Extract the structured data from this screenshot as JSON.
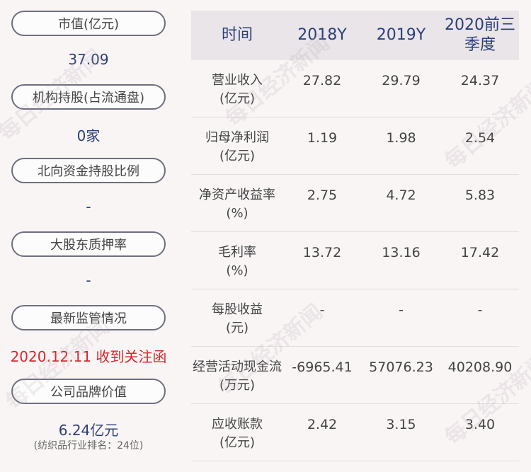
{
  "left_panel": [
    {
      "label": "市值(亿元)",
      "value": "37.09"
    },
    {
      "label": "机构持股(占流通盘)",
      "value": "0家"
    },
    {
      "label": "北向资金持股比例",
      "value": "-"
    },
    {
      "label": "大股东质押率",
      "value": "-"
    },
    {
      "label": "最新监管情况",
      "value": "2020.12.11 收到关注函"
    },
    {
      "label": "公司品牌价值",
      "value": "6.24亿元",
      "sub": "(纺织品行业排名：24位)"
    }
  ],
  "table": {
    "headers": [
      "时间",
      "2018Y",
      "2019Y",
      "2020前三季度"
    ],
    "rows": [
      {
        "label": [
          "营业收入",
          "(亿元)"
        ],
        "values": [
          "27.82",
          "29.79",
          "24.37"
        ]
      },
      {
        "label": [
          "归母净利润",
          "(亿元)"
        ],
        "values": [
          "1.19",
          "1.98",
          "2.54"
        ]
      },
      {
        "label": [
          "净资产收益率",
          "(%)"
        ],
        "values": [
          "2.75",
          "4.72",
          "5.83"
        ]
      },
      {
        "label": [
          "毛利率",
          "(%)"
        ],
        "values": [
          "13.72",
          "13.16",
          "17.42"
        ]
      },
      {
        "label": [
          "每股收益",
          "(元)"
        ],
        "values": [
          "-",
          "-",
          "-"
        ]
      },
      {
        "label": [
          "经营活动现金流",
          "(万元)"
        ],
        "values": [
          "-6965.41",
          "57076.23",
          "40208.90"
        ]
      },
      {
        "label": [
          "应收账款",
          "(亿元)"
        ],
        "values": [
          "2.42",
          "3.15",
          "3.40"
        ]
      }
    ]
  },
  "watermark": "每日经济新闻",
  "colors": {
    "accent": "#2c3f7a",
    "alert": "#d8262d",
    "header_bg": "#e9e5e8"
  }
}
